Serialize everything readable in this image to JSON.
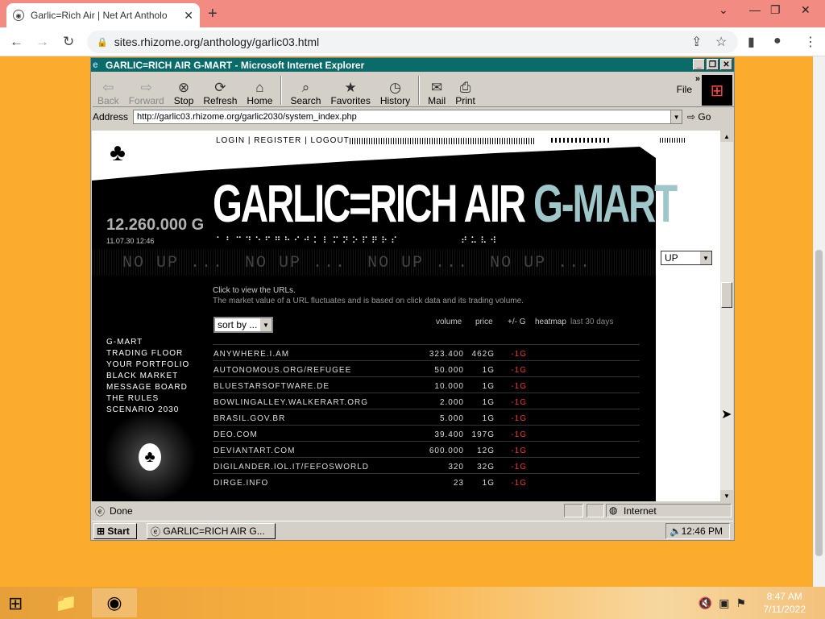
{
  "browser": {
    "tab_title": "Garlic=Rich Air | Net Art Antholo",
    "url": "sites.rhizome.org/anthology/garlic03.html",
    "window_controls": [
      "chevron-down-icon",
      "minimize-icon",
      "restore-icon",
      "close-icon"
    ]
  },
  "ie": {
    "window_title": "GARLIC=RICH AIR G-MART - Microsoft Internet Explorer",
    "toolbar": [
      "Back",
      "Forward",
      "Stop",
      "Refresh",
      "Home",
      "Search",
      "Favorites",
      "History",
      "Mail",
      "Print"
    ],
    "file_menu": "File",
    "address_label": "Address",
    "address_url": "http://garlic03.rhizome.org/garlic2030/system_index.php",
    "go_label": "Go",
    "status_text": "Done",
    "zone_text": "Internet",
    "start_label": "Start",
    "task_item": "GARLIC=RICH AIR G...",
    "tray_time": "12:46 PM"
  },
  "page": {
    "top_links": "LOGIN | REGISTER | LOGOUT",
    "amount": "12.260.000 G",
    "timestamp": "11.07.30 12:46",
    "banner_white": "GARLIC=RICH AIR",
    "banner_accent": "G-MART",
    "ticker": [
      "NO UP ...",
      "NO UP ...",
      "NO UP ...",
      "NO UP ..."
    ],
    "up_select": "UP",
    "intro_line1": "Click to view the URLs.",
    "intro_line2": "The market value of a URL fluctuates and is based on click data and its trading volume.",
    "sort_label": "sort by ...",
    "headers": {
      "volume": "volume",
      "price": "price",
      "change": "+/- G",
      "heatmap": "heatmap",
      "heatmap_sub": "last 30 days"
    },
    "nav": [
      "G-MART",
      "TRADING FLOOR",
      "YOUR PORTFOLIO",
      "BLACK MARKET",
      "MESSAGE BOARD",
      "THE RULES",
      "SCENARIO 2030"
    ],
    "rows": [
      {
        "name": "ANYWHERE.I.AM",
        "volume": "323.400",
        "price": "462G",
        "change": "-1G"
      },
      {
        "name": "AUTONOMOUS.ORG/REFUGEE",
        "volume": "50.000",
        "price": "1G",
        "change": "-1G"
      },
      {
        "name": "BLUESTARSOFTWARE.DE",
        "volume": "10.000",
        "price": "1G",
        "change": "-1G"
      },
      {
        "name": "BOWLINGALLEY.WALKERART.ORG",
        "volume": "2.000",
        "price": "1G",
        "change": "-1G"
      },
      {
        "name": "BRASIL.GOV.BR",
        "volume": "5.000",
        "price": "1G",
        "change": "-1G"
      },
      {
        "name": "DEO.COM",
        "volume": "39.400",
        "price": "197G",
        "change": "-1G"
      },
      {
        "name": "DEVIANTART.COM",
        "volume": "600.000",
        "price": "12G",
        "change": "-1G"
      },
      {
        "name": "DIGILANDER.IOL.IT/FEFOSWORLD",
        "volume": "320",
        "price": "32G",
        "change": "-1G"
      },
      {
        "name": "DIRGE.INFO",
        "volume": "23",
        "price": "1G",
        "change": "-1G"
      }
    ]
  },
  "desktop": {
    "clock_time": "8:47 AM",
    "clock_date": "7/11/2022"
  }
}
